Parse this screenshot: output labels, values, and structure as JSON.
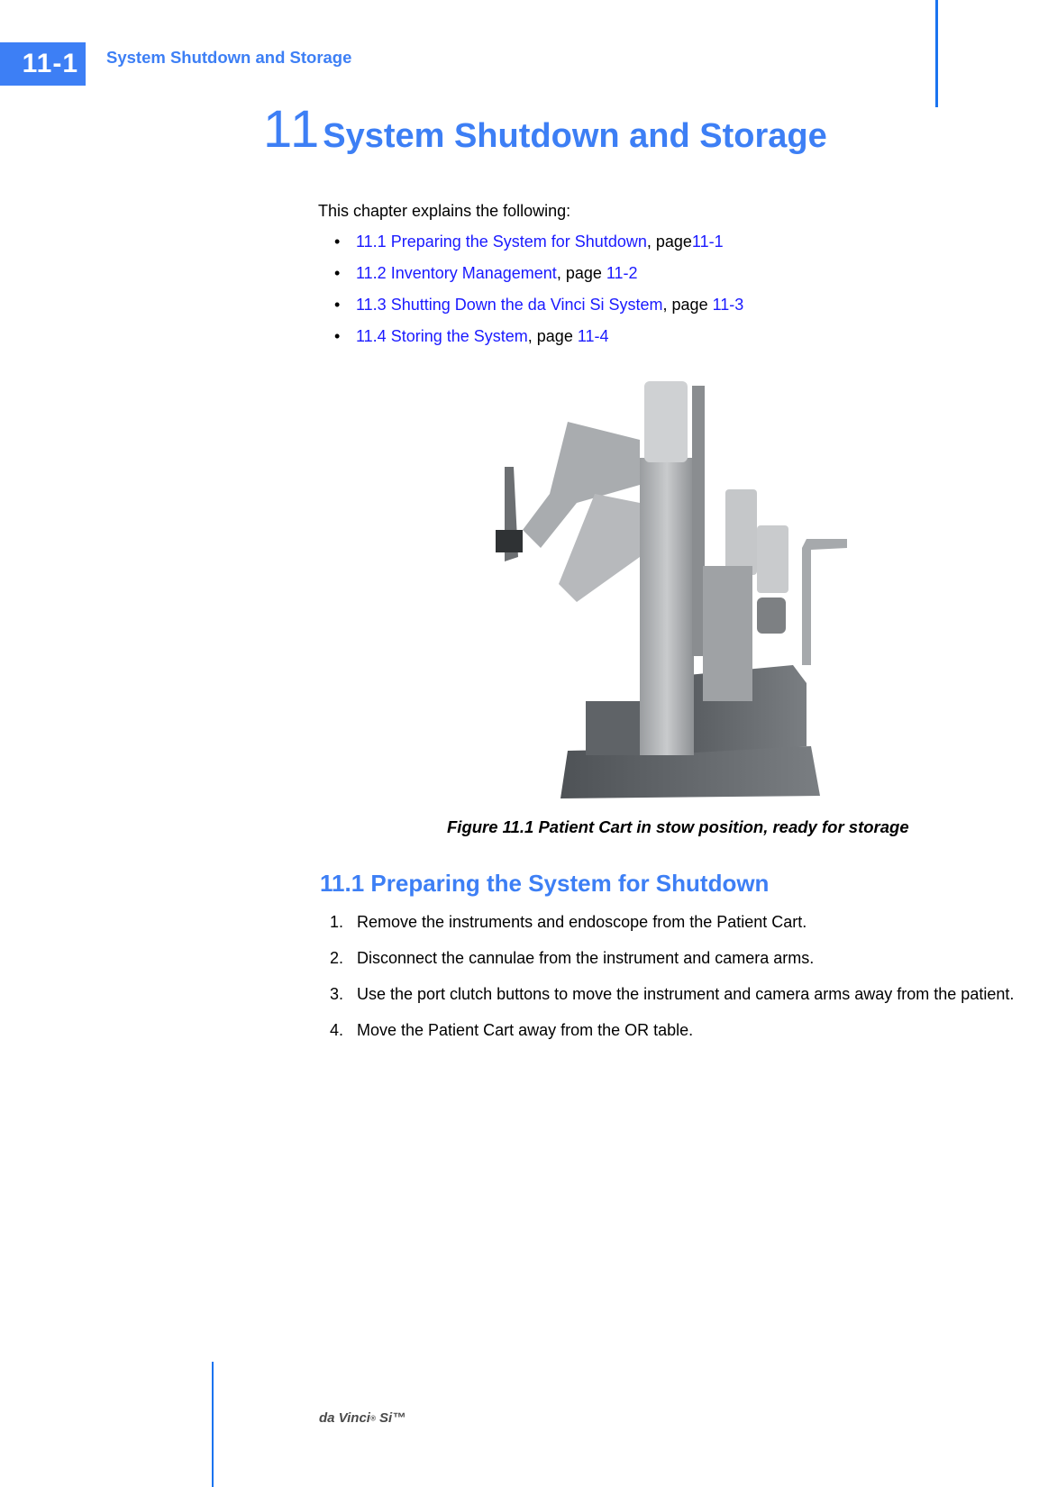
{
  "header": {
    "page_number": "11-1",
    "running_title": "System Shutdown and Storage",
    "accent_color": "#3d7ff5"
  },
  "chapter": {
    "number": "11",
    "title": "System Shutdown and Storage"
  },
  "intro": {
    "text": "This chapter explains the following:"
  },
  "toc": [
    {
      "link_text": "11.1 Preparing the System for Shutdown",
      "page_label": ", page",
      "page_ref": "11-1"
    },
    {
      "link_text": "11.2 Inventory Management",
      "page_label": ", page ",
      "page_ref": "11-2"
    },
    {
      "link_text": "11.3 Shutting Down the da Vinci Si System",
      "page_label": ", page ",
      "page_ref": "11-3"
    },
    {
      "link_text": "11.4 Storing the System",
      "page_label": ", page ",
      "page_ref": "11-4"
    }
  ],
  "figure": {
    "subject": "Patient Cart robot in stow position",
    "caption": "Figure 11.1 Patient Cart in stow position, ready for storage"
  },
  "section": {
    "heading": "11.1 Preparing the System for Shutdown",
    "steps": [
      {
        "num": "1.",
        "text": "Remove the instruments and endoscope from the Patient Cart."
      },
      {
        "num": "2.",
        "text": "Disconnect the cannulae from the instrument and camera arms."
      },
      {
        "num": "3.",
        "text": "Use the port clutch buttons to move the instrument and camera arms away from the patient."
      },
      {
        "num": "4.",
        "text": "Move the Patient Cart away from the OR table."
      }
    ]
  },
  "footer": {
    "brand": "da Vinci",
    "registered": "®",
    "model": " Si™"
  }
}
